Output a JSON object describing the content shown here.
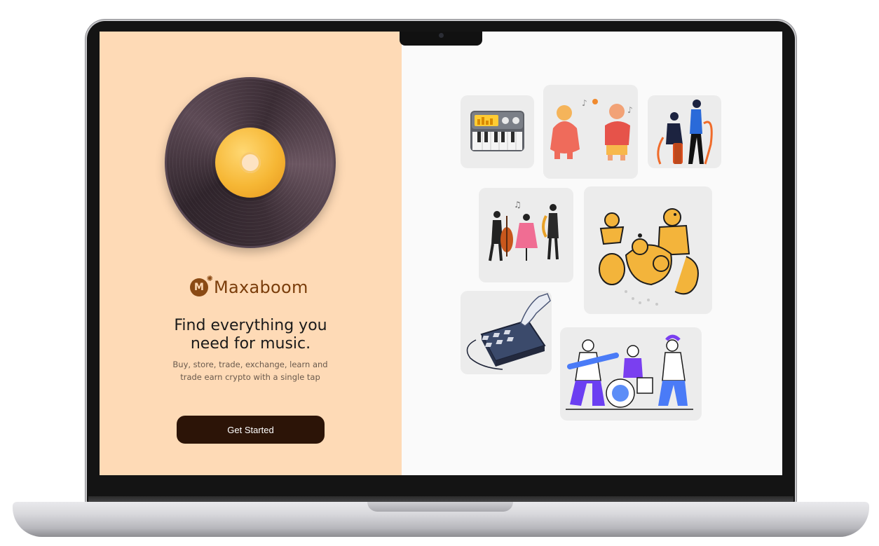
{
  "app": {
    "brand_name": "Maxaboom",
    "brand_mark_letter": "M"
  },
  "hero": {
    "headline_line1": "Find everything you",
    "headline_line2": "need for music.",
    "subtitle_line1": "Buy, store, trade, exchange, learn and",
    "subtitle_line2": "trade earn crypto with a single tap",
    "cta_label": "Get Started"
  },
  "colors": {
    "left_pane": "#fedab6",
    "right_pane": "#fafafa",
    "cta": "#2c1407",
    "brand": "#7a3d0b",
    "accent_yellow": "#f6b735",
    "accent_purple": "#6b3ff2"
  },
  "illustrations": [
    {
      "icon": "synthesizer-icon"
    },
    {
      "icon": "singers-illustration"
    },
    {
      "icon": "drummer-dancer-illustration"
    },
    {
      "icon": "orchestra-trio-illustration"
    },
    {
      "icon": "brass-band-illustration"
    },
    {
      "icon": "drum-machine-illustration"
    },
    {
      "icon": "rock-band-illustration"
    }
  ]
}
